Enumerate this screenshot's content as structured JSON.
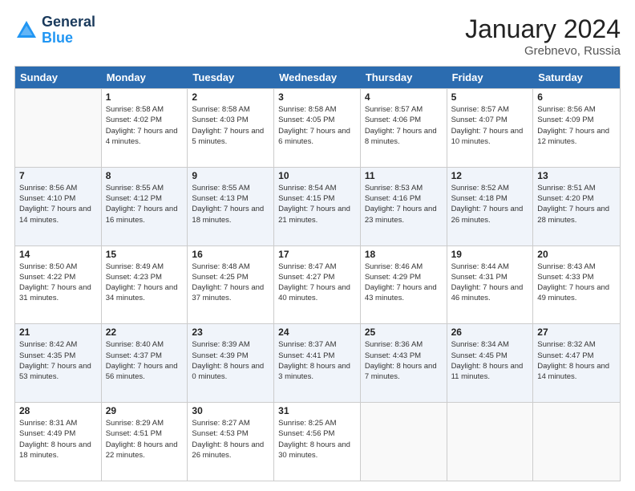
{
  "logo": {
    "line1": "General",
    "line2": "Blue"
  },
  "title": "January 2024",
  "subtitle": "Grebnevo, Russia",
  "weekdays": [
    "Sunday",
    "Monday",
    "Tuesday",
    "Wednesday",
    "Thursday",
    "Friday",
    "Saturday"
  ],
  "rows": [
    [
      {
        "day": "",
        "sunrise": "",
        "sunset": "",
        "daylight": ""
      },
      {
        "day": "1",
        "sunrise": "Sunrise: 8:58 AM",
        "sunset": "Sunset: 4:02 PM",
        "daylight": "Daylight: 7 hours and 4 minutes."
      },
      {
        "day": "2",
        "sunrise": "Sunrise: 8:58 AM",
        "sunset": "Sunset: 4:03 PM",
        "daylight": "Daylight: 7 hours and 5 minutes."
      },
      {
        "day": "3",
        "sunrise": "Sunrise: 8:58 AM",
        "sunset": "Sunset: 4:05 PM",
        "daylight": "Daylight: 7 hours and 6 minutes."
      },
      {
        "day": "4",
        "sunrise": "Sunrise: 8:57 AM",
        "sunset": "Sunset: 4:06 PM",
        "daylight": "Daylight: 7 hours and 8 minutes."
      },
      {
        "day": "5",
        "sunrise": "Sunrise: 8:57 AM",
        "sunset": "Sunset: 4:07 PM",
        "daylight": "Daylight: 7 hours and 10 minutes."
      },
      {
        "day": "6",
        "sunrise": "Sunrise: 8:56 AM",
        "sunset": "Sunset: 4:09 PM",
        "daylight": "Daylight: 7 hours and 12 minutes."
      }
    ],
    [
      {
        "day": "7",
        "sunrise": "Sunrise: 8:56 AM",
        "sunset": "Sunset: 4:10 PM",
        "daylight": "Daylight: 7 hours and 14 minutes."
      },
      {
        "day": "8",
        "sunrise": "Sunrise: 8:55 AM",
        "sunset": "Sunset: 4:12 PM",
        "daylight": "Daylight: 7 hours and 16 minutes."
      },
      {
        "day": "9",
        "sunrise": "Sunrise: 8:55 AM",
        "sunset": "Sunset: 4:13 PM",
        "daylight": "Daylight: 7 hours and 18 minutes."
      },
      {
        "day": "10",
        "sunrise": "Sunrise: 8:54 AM",
        "sunset": "Sunset: 4:15 PM",
        "daylight": "Daylight: 7 hours and 21 minutes."
      },
      {
        "day": "11",
        "sunrise": "Sunrise: 8:53 AM",
        "sunset": "Sunset: 4:16 PM",
        "daylight": "Daylight: 7 hours and 23 minutes."
      },
      {
        "day": "12",
        "sunrise": "Sunrise: 8:52 AM",
        "sunset": "Sunset: 4:18 PM",
        "daylight": "Daylight: 7 hours and 26 minutes."
      },
      {
        "day": "13",
        "sunrise": "Sunrise: 8:51 AM",
        "sunset": "Sunset: 4:20 PM",
        "daylight": "Daylight: 7 hours and 28 minutes."
      }
    ],
    [
      {
        "day": "14",
        "sunrise": "Sunrise: 8:50 AM",
        "sunset": "Sunset: 4:22 PM",
        "daylight": "Daylight: 7 hours and 31 minutes."
      },
      {
        "day": "15",
        "sunrise": "Sunrise: 8:49 AM",
        "sunset": "Sunset: 4:23 PM",
        "daylight": "Daylight: 7 hours and 34 minutes."
      },
      {
        "day": "16",
        "sunrise": "Sunrise: 8:48 AM",
        "sunset": "Sunset: 4:25 PM",
        "daylight": "Daylight: 7 hours and 37 minutes."
      },
      {
        "day": "17",
        "sunrise": "Sunrise: 8:47 AM",
        "sunset": "Sunset: 4:27 PM",
        "daylight": "Daylight: 7 hours and 40 minutes."
      },
      {
        "day": "18",
        "sunrise": "Sunrise: 8:46 AM",
        "sunset": "Sunset: 4:29 PM",
        "daylight": "Daylight: 7 hours and 43 minutes."
      },
      {
        "day": "19",
        "sunrise": "Sunrise: 8:44 AM",
        "sunset": "Sunset: 4:31 PM",
        "daylight": "Daylight: 7 hours and 46 minutes."
      },
      {
        "day": "20",
        "sunrise": "Sunrise: 8:43 AM",
        "sunset": "Sunset: 4:33 PM",
        "daylight": "Daylight: 7 hours and 49 minutes."
      }
    ],
    [
      {
        "day": "21",
        "sunrise": "Sunrise: 8:42 AM",
        "sunset": "Sunset: 4:35 PM",
        "daylight": "Daylight: 7 hours and 53 minutes."
      },
      {
        "day": "22",
        "sunrise": "Sunrise: 8:40 AM",
        "sunset": "Sunset: 4:37 PM",
        "daylight": "Daylight: 7 hours and 56 minutes."
      },
      {
        "day": "23",
        "sunrise": "Sunrise: 8:39 AM",
        "sunset": "Sunset: 4:39 PM",
        "daylight": "Daylight: 8 hours and 0 minutes."
      },
      {
        "day": "24",
        "sunrise": "Sunrise: 8:37 AM",
        "sunset": "Sunset: 4:41 PM",
        "daylight": "Daylight: 8 hours and 3 minutes."
      },
      {
        "day": "25",
        "sunrise": "Sunrise: 8:36 AM",
        "sunset": "Sunset: 4:43 PM",
        "daylight": "Daylight: 8 hours and 7 minutes."
      },
      {
        "day": "26",
        "sunrise": "Sunrise: 8:34 AM",
        "sunset": "Sunset: 4:45 PM",
        "daylight": "Daylight: 8 hours and 11 minutes."
      },
      {
        "day": "27",
        "sunrise": "Sunrise: 8:32 AM",
        "sunset": "Sunset: 4:47 PM",
        "daylight": "Daylight: 8 hours and 14 minutes."
      }
    ],
    [
      {
        "day": "28",
        "sunrise": "Sunrise: 8:31 AM",
        "sunset": "Sunset: 4:49 PM",
        "daylight": "Daylight: 8 hours and 18 minutes."
      },
      {
        "day": "29",
        "sunrise": "Sunrise: 8:29 AM",
        "sunset": "Sunset: 4:51 PM",
        "daylight": "Daylight: 8 hours and 22 minutes."
      },
      {
        "day": "30",
        "sunrise": "Sunrise: 8:27 AM",
        "sunset": "Sunset: 4:53 PM",
        "daylight": "Daylight: 8 hours and 26 minutes."
      },
      {
        "day": "31",
        "sunrise": "Sunrise: 8:25 AM",
        "sunset": "Sunset: 4:56 PM",
        "daylight": "Daylight: 8 hours and 30 minutes."
      },
      {
        "day": "",
        "sunrise": "",
        "sunset": "",
        "daylight": ""
      },
      {
        "day": "",
        "sunrise": "",
        "sunset": "",
        "daylight": ""
      },
      {
        "day": "",
        "sunrise": "",
        "sunset": "",
        "daylight": ""
      }
    ]
  ]
}
